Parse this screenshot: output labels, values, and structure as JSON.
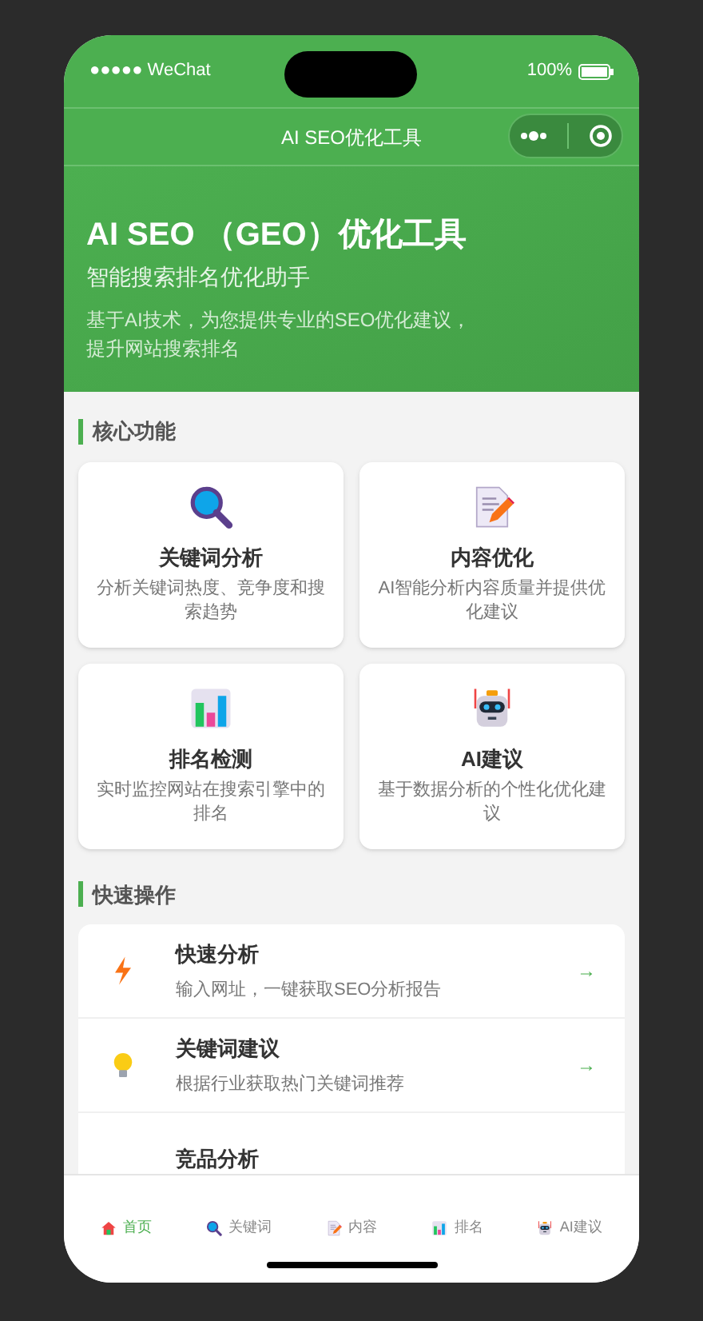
{
  "status_bar": {
    "carrier": "●●●●● WeChat",
    "battery": "100%"
  },
  "nav": {
    "title": "AI SEO优化工具"
  },
  "hero": {
    "title": "AI SEO （GEO）优化工具",
    "subtitle": "智能搜索排名优化助手",
    "description": "基于AI技术，为您提供专业的SEO优化建议，提升网站搜索排名"
  },
  "features": {
    "title": "核心功能",
    "items": [
      {
        "kind": "search",
        "title": "关键词分析",
        "description": "分析关键词热度、竞争度和搜索趋势"
      },
      {
        "kind": "document",
        "title": "内容优化",
        "description": "AI智能分析内容质量并提供优化建议"
      },
      {
        "kind": "chart",
        "title": "排名检测",
        "description": "实时监控网站在搜索引擎中的排名"
      },
      {
        "kind": "robot",
        "title": "AI建议",
        "description": "基于数据分析的个性化优化建议"
      }
    ]
  },
  "quick_actions": {
    "title": "快速操作",
    "items": [
      {
        "kind": "bolt",
        "title": "快速分析",
        "description": "输入网址，一键获取SEO分析报告",
        "arrow": "→"
      },
      {
        "kind": "bulb",
        "title": "关键词建议",
        "description": "根据行业获取热门关键词推荐",
        "arrow": "→"
      },
      {
        "kind": "none",
        "title": "竞品分析"
      }
    ]
  },
  "tab_bar": [
    {
      "kind": "home",
      "label": "首页",
      "selected": true
    },
    {
      "kind": "search",
      "label": "关键词",
      "selected": false
    },
    {
      "kind": "document",
      "label": "内容",
      "selected": false
    },
    {
      "kind": "chart",
      "label": "排名",
      "selected": false
    },
    {
      "kind": "robot",
      "label": "AI建议",
      "selected": false
    }
  ]
}
